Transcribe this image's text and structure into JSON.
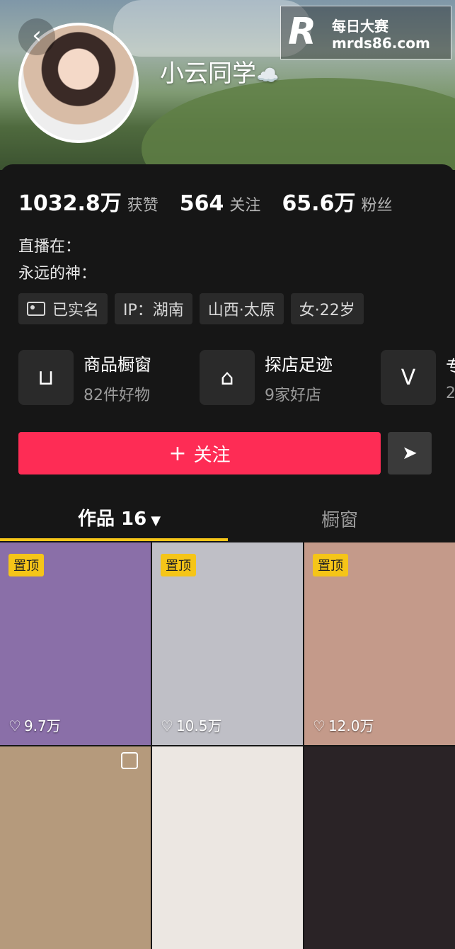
{
  "header": {
    "back_icon": "chevron-left-icon",
    "username": "小云同学",
    "username_emoji": "☁️"
  },
  "watermark": {
    "logo": "R",
    "line1": "每日大赛",
    "line2": "mrds86.com"
  },
  "stats": [
    {
      "value": "1032.8万",
      "label": "获赞"
    },
    {
      "value": "564",
      "label": "关注"
    },
    {
      "value": "65.6万",
      "label": "粉丝"
    }
  ],
  "bio": {
    "line1": "直播在：",
    "line2": "永远的神："
  },
  "tags": [
    {
      "label": "已实名",
      "icon": "id-card-icon"
    },
    {
      "label": "IP：湖南"
    },
    {
      "label": "山西·太原"
    },
    {
      "label": "女·22岁"
    }
  ],
  "features": [
    {
      "title": "商品橱窗",
      "subtitle": "82件好物",
      "icon": "shopping-bag-icon"
    },
    {
      "title": "探店足迹",
      "subtitle": "9家好店",
      "icon": "store-icon"
    },
    {
      "title": "专",
      "subtitle": "2",
      "icon": "v-icon"
    }
  ],
  "actions": {
    "follow_label": "关注",
    "follow_icon": "plus-icon",
    "share_icon": "send-icon"
  },
  "tabs": {
    "works_label": "作品 16",
    "window_label": "橱窗"
  },
  "grid": [
    {
      "pinned": "置顶",
      "likes": "9.7万",
      "color": "#8a6fa8"
    },
    {
      "pinned": "置顶",
      "likes": "10.5万",
      "color": "#bfbfc6"
    },
    {
      "pinned": "置顶",
      "likes": "12.0万",
      "color": "#c49a8a"
    },
    {
      "pinned": "",
      "likes": "",
      "color": "#b59a7c"
    },
    {
      "pinned": "",
      "likes": "",
      "color": "#ece7e2"
    },
    {
      "pinned": "",
      "likes": "",
      "color": "#2a2326"
    }
  ]
}
